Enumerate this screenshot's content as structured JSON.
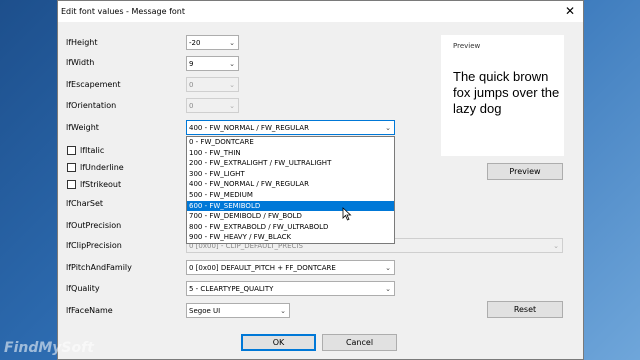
{
  "window": {
    "title": "Edit font values - Message font",
    "close_glyph": "✕"
  },
  "labels": {
    "height": "lfHeight",
    "width": "lfWidth",
    "escapement": "lfEscapement",
    "orientation": "lfOrientation",
    "weight": "lfWeight",
    "italic": "lfItalic",
    "underline": "lfUnderline",
    "strikeout": "lfStrikeout",
    "charset": "lfCharSet",
    "outprecision": "lfOutPrecision",
    "clipprecision": "lfClipPrecision",
    "pitchfamily": "lfPitchAndFamily",
    "quality": "lfQuality",
    "facename": "lfFaceName"
  },
  "values": {
    "height": "-20",
    "width": "9",
    "escapement": "0",
    "orientation": "0",
    "weight": "400 - FW_NORMAL / FW_REGULAR",
    "clipprecision": "0 [0x00] - CLIP_DEFAULT_PRECIS",
    "pitchfamily": "0 [0x00] DEFAULT_PITCH + FF_DONTCARE",
    "quality": "5 - CLEARTYPE_QUALITY",
    "facename": "Segoe UI"
  },
  "weight_options": [
    "0 - FW_DONTCARE",
    "100 - FW_THIN",
    "200 - FW_EXTRALIGHT / FW_ULTRALIGHT",
    "300 - FW_LIGHT",
    "400 - FW_NORMAL / FW_REGULAR",
    "500 - FW_MEDIUM",
    "600 - FW_SEMIBOLD",
    "700 - FW_DEMIBOLD / FW_BOLD",
    "800 - FW_EXTRABOLD / FW_ULTRABOLD",
    "900 - FW_HEAVY / FW_BLACK"
  ],
  "highlighted_option_index": 6,
  "preview": {
    "caption": "Preview",
    "sample": "The quick brown fox jumps over the lazy dog"
  },
  "buttons": {
    "preview": "Preview",
    "reset": "Reset",
    "ok": "OK",
    "cancel": "Cancel"
  },
  "watermark": "FindMySoft",
  "colors": {
    "selection": "#0078d7",
    "ok_border": "#0078d7"
  }
}
